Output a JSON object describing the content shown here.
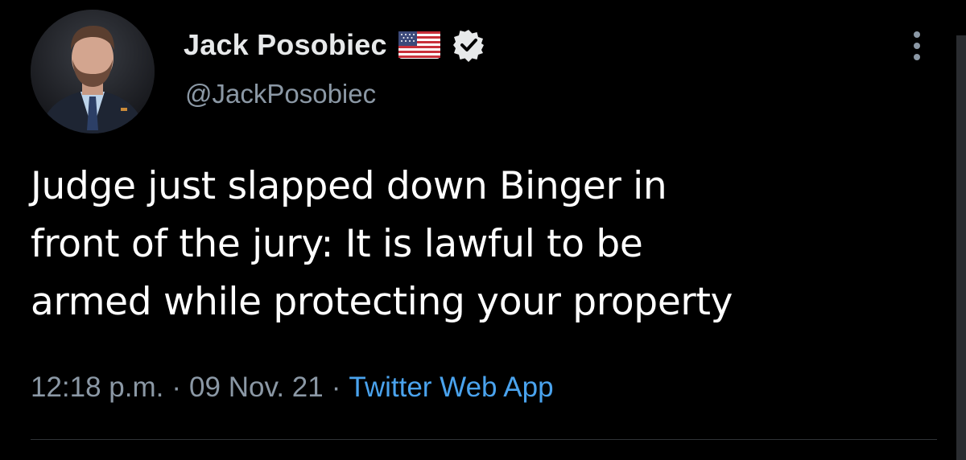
{
  "user": {
    "display_name": "Jack Posobiec",
    "handle": "@JackPosobiec",
    "flag_icon": "us-flag-icon",
    "verified_icon": "verified-badge-icon"
  },
  "tweet": {
    "text_lines": [
      "Judge just slapped down Binger in",
      "front of the jury: It is lawful to be",
      "armed while protecting your property"
    ],
    "time": "12:18 p.m.",
    "date": "09 Nov. 21",
    "separator": "·",
    "source": "Twitter Web App"
  },
  "menu": {
    "icon": "more-vertical-icon"
  },
  "colors": {
    "background": "#000000",
    "text": "#ffffff",
    "secondary": "#8b98a5",
    "link": "#4aa3ee"
  }
}
